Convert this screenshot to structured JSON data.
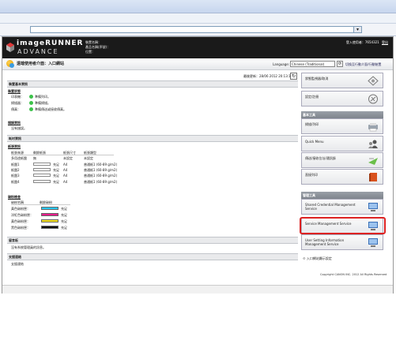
{
  "header": {
    "logo_line1": "imageRUNNER",
    "logo_line2": "ADVANCE",
    "device_name_label": "裝置名稱：",
    "product_name_label": "產品名稱(序號)：",
    "location_label": "位置：",
    "user_line": "登入使用者：7654321",
    "logout_label": "登出"
  },
  "titlebar": {
    "title": "遠端使用者介面：入口網站",
    "language_label": "Language:",
    "language_value": "Chinese (Traditional)",
    "mobile_link": "切換至行動介面/行動裝置"
  },
  "main": {
    "last_updated": "最後更新：28/06 2012 20:13:18",
    "sections": {
      "device_basic": "裝置基本資訊",
      "consumables": "耗材資訊",
      "message_board": "留言板",
      "support_link": "支援連結"
    },
    "device_status": {
      "heading": "裝置狀態",
      "rows": [
        {
          "label": "印表機：",
          "value": "準備列印。"
        },
        {
          "label": "掃描器：",
          "value": "準備掃描。"
        },
        {
          "label": "傳真：",
          "value": "準備傳送或接收傳真。"
        }
      ]
    },
    "error_info": {
      "heading": "錯誤資訊",
      "value": "沒有錯誤。"
    },
    "paper_info": {
      "heading": "紙張資訊",
      "columns": [
        "紙張來源",
        "剩餘紙張",
        "紙張尺寸",
        "紙張類型"
      ],
      "rows": [
        {
          "source": "多用途紙盤",
          "level": "無",
          "size": "未設定",
          "type": "未設定"
        },
        {
          "source": "紙盤1",
          "level": "",
          "status": "充足",
          "size": "A4",
          "type": "普通紙1 (60-89 g/m2)"
        },
        {
          "source": "紙盤2",
          "level": "",
          "status": "充足",
          "size": "A4",
          "type": "普通紙1 (60-89 g/m2)"
        },
        {
          "source": "紙盤3",
          "level": "",
          "status": "充足",
          "size": "A4",
          "type": "普通紙1 (60-89 g/m2)"
        },
        {
          "source": "紙盤4",
          "level": "",
          "status": "充足",
          "size": "A4",
          "type": "普通紙1 (60-89 g/m2)"
        }
      ]
    },
    "toner_info": {
      "heading": "碳粉檢查",
      "columns": [
        "碳粉名稱",
        "剩餘碳粉"
      ],
      "rows": [
        {
          "name": "黃色碳粉匣：",
          "color": "#28c8f0",
          "status": "充足"
        },
        {
          "name": "洋紅色碳粉匣：",
          "color": "#e81e8c",
          "status": "充足"
        },
        {
          "name": "黃色碳粉匣：",
          "color": "#f5e11e",
          "status": "充足"
        },
        {
          "name": "黑色碳粉匣：",
          "color": "#111111",
          "status": "充足"
        }
      ]
    },
    "message_board_text": "沒有系統管理員的訊息。",
    "support_link_text": "支援連結"
  },
  "sidebar": {
    "status_monitor": "狀態監視器/取消",
    "settings": "設定/註冊",
    "basic_tools_heading": "基本工具",
    "scan": "掃描/列印",
    "quick_menu": "Quick Menu",
    "address_book": "傳送/接收位址/通訊錄",
    "direct_print": "直接列印",
    "mgmt_tools_heading": "管理工具",
    "shared_credential": "Shared Credential Management Service",
    "service_mgmt": "Service Management Service",
    "user_setting": "User Setting Information Management Service",
    "portal_link": "入口網站顯示設定",
    "copyright": "Copyright CANON INC. 2012 All Rights Reserved"
  },
  "colors": {
    "highlight": "#dd2222",
    "status_ok": "#3cc24a"
  }
}
